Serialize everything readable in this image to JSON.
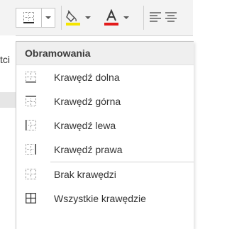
{
  "sheet": {
    "partial_label": "tci"
  },
  "toolbar": {
    "borders_button": "borders",
    "fill_color": "#f5e500",
    "font_color": "#e31b1b"
  },
  "menu": {
    "header": "Obramowania",
    "items": [
      {
        "label": "Krawędź dolna",
        "icon": "border-bottom-icon"
      },
      {
        "label": "Krawędź górna",
        "icon": "border-top-icon"
      },
      {
        "label": "Krawędź lewa",
        "icon": "border-left-icon"
      },
      {
        "label": "Krawędź prawa",
        "icon": "border-right-icon"
      },
      {
        "label": "Brak krawędzi",
        "icon": "no-border-icon"
      },
      {
        "label": "Wszystkie krawędzie",
        "icon": "all-borders-icon"
      }
    ]
  }
}
